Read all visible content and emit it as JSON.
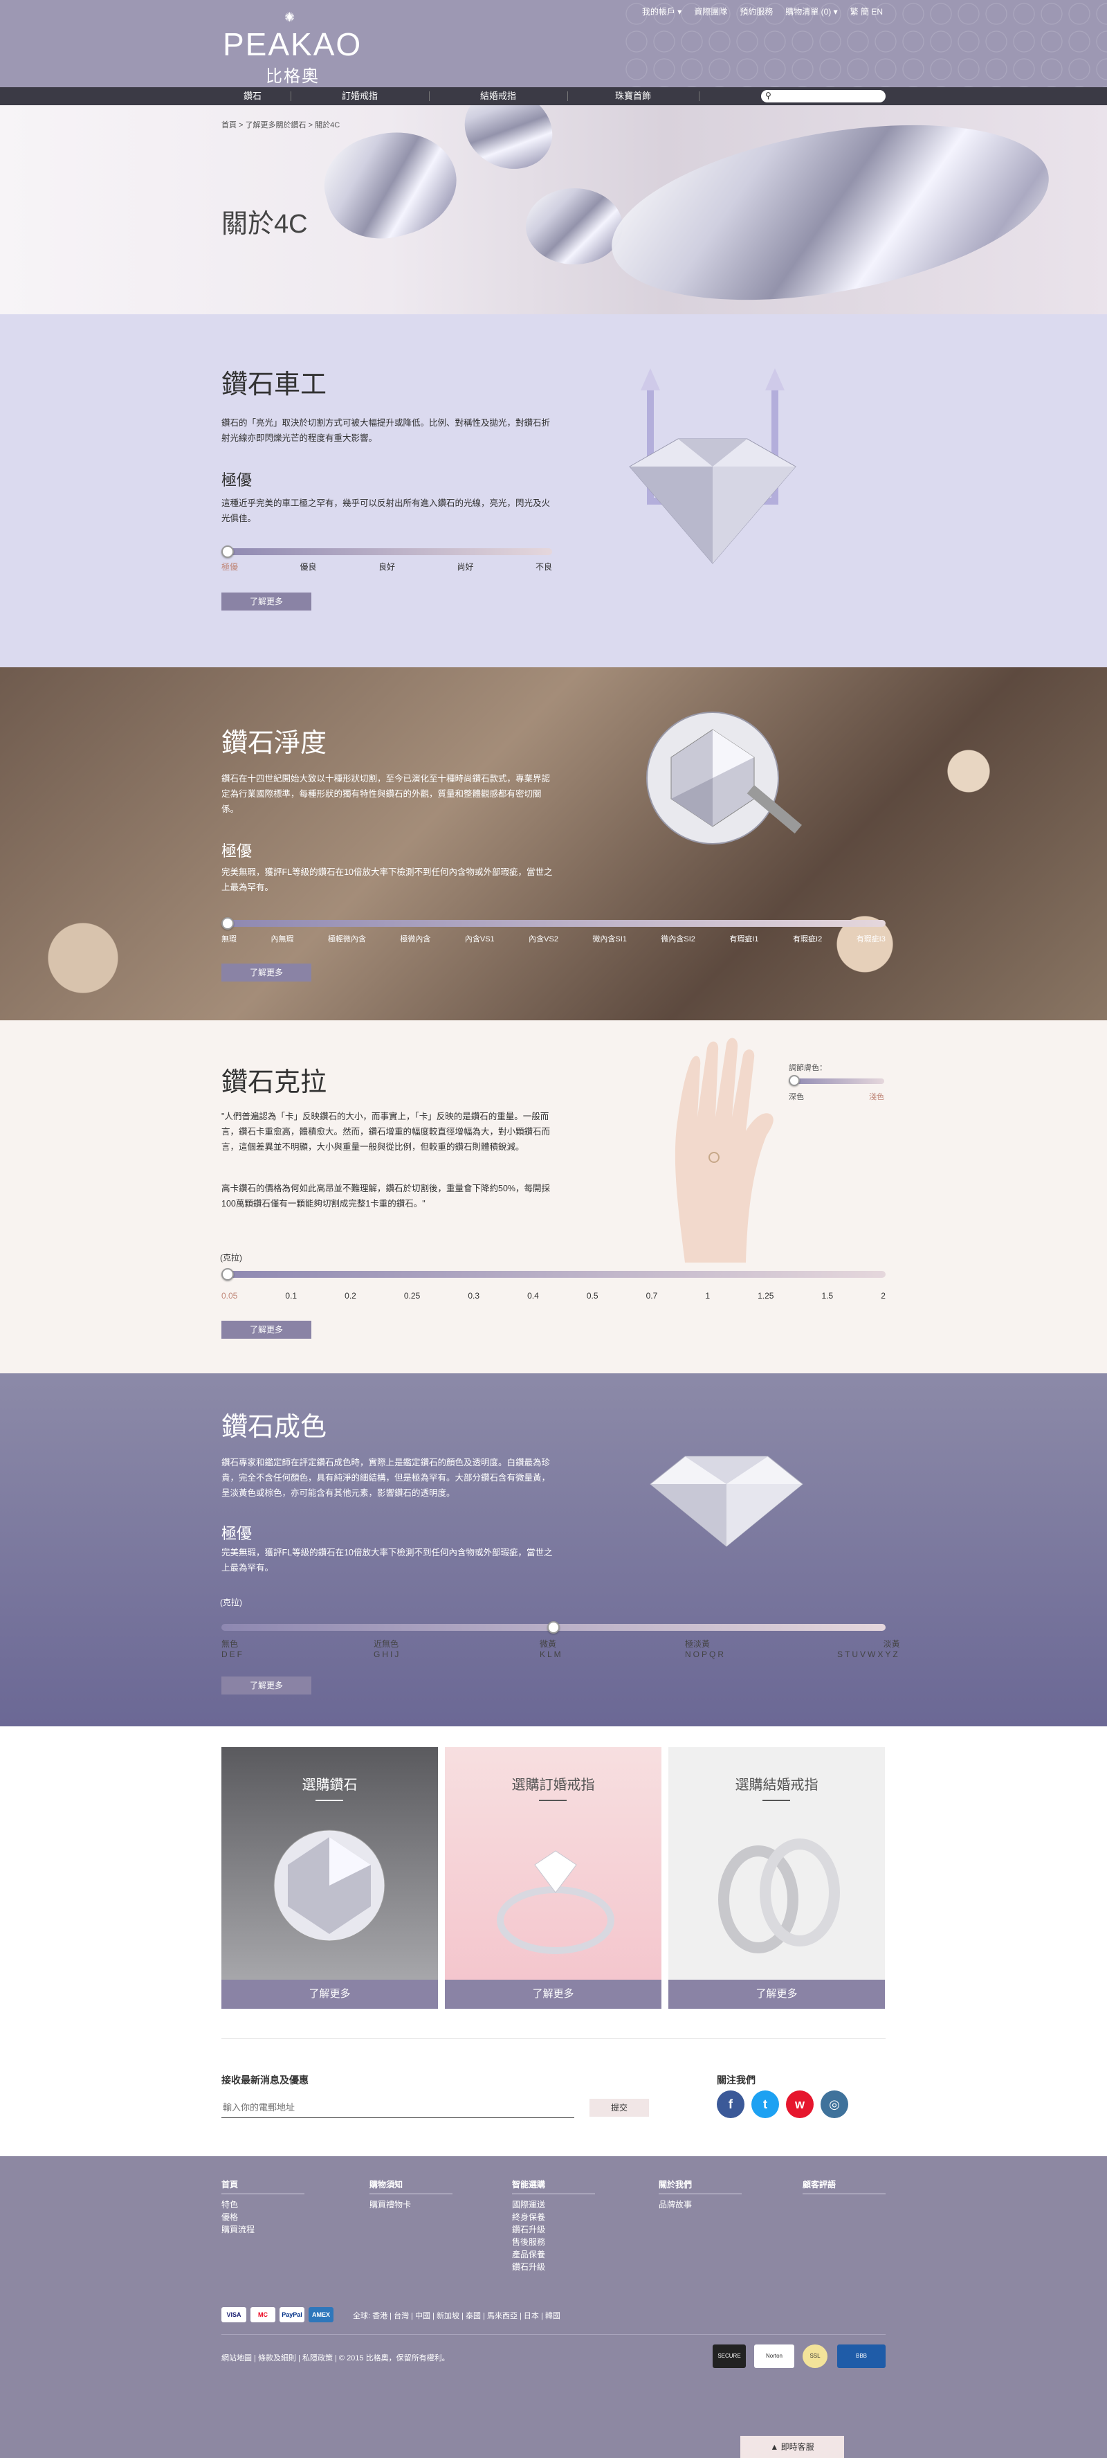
{
  "header": {
    "logo_en": "PEAKAO",
    "logo_zh": "比格奧",
    "top_links": [
      "我的帳戶 ▾",
      "資際團隊",
      "預約服務",
      "購物清單 (0) ▾",
      "繁 簡 EN"
    ]
  },
  "nav": {
    "items": [
      "鑽石",
      "訂婚戒指",
      "結婚戒指",
      "珠寶首飾"
    ],
    "search_placeholder": ""
  },
  "hero": {
    "breadcrumb": [
      "首頁",
      "了解更多關於鑽石",
      "關於4C"
    ],
    "breadcrumb_sep": ">",
    "title": "關於4C"
  },
  "cut": {
    "title": "鑽石車工",
    "desc": "鑽石的「亮光」取決於切割方式可被大幅提升或降低。比例、對稱性及拋光，對鑽石折射光線亦即閃爍光芒的程度有重大影響。",
    "grade": "極優",
    "grade_desc": "這種近乎完美的車工極之罕有，幾乎可以反射出所有進入鑽石的光線，亮光，閃光及火光俱佳。",
    "scale": [
      "極優",
      "優良",
      "良好",
      "尚好",
      "不良"
    ],
    "selected_index": 0,
    "button": "了解更多"
  },
  "clarity": {
    "title": "鑽石淨度",
    "desc": "鑽石在十四世紀開始大致以十種形狀切割，至今已演化至十種時尚鑽石款式，專業界認定為行業國際標準，每種形狀的獨有特性與鑽石的外觀，質量和整體觀感都有密切關係。",
    "grade": "極優",
    "grade_desc": "完美無瑕，獲評FL等級的鑽石在10倍放大率下檢測不到任何內含物或外部瑕疵，當世之上最為罕有。",
    "scale": [
      "無瑕",
      "內無瑕",
      "極輕微內含",
      "極微內含",
      "內含VS1",
      "內含VS2",
      "微內含SI1",
      "微內含SI2",
      "有瑕疵I1",
      "有瑕疵I2",
      "有瑕疵I3"
    ],
    "selected_index": 0,
    "button": "了解更多"
  },
  "carat": {
    "title": "鑽石克拉",
    "desc1": "\"人們普遍認為「卡」反映鑽石的大小，而事實上，「卡」反映的是鑽石的重量。一般而言，鑽石卡重愈高，體積愈大。然而，鑽石增重的幅度較直徑增幅為大，對小顆鑽石而言，這個差異並不明顯，大小與重量一般與從比例，但較重的鑽石則體積銳減。",
    "desc2": "高卡鑽石的價格為何如此高昂並不難理解，鑽石於切割後，重量會下降約50%，每開採100萬顆鑽石僅有一顆能夠切割成完整1卡重的鑽石。\"",
    "skin_label": "調節膚色：",
    "skin_scale": [
      "深色",
      "淺色"
    ],
    "unit": "(克拉)",
    "scale": [
      "0.05",
      "0.1",
      "0.2",
      "0.25",
      "0.3",
      "0.4",
      "0.5",
      "0.7",
      "1",
      "1.25",
      "1.5",
      "2"
    ],
    "selected_index": 0,
    "button": "了解更多"
  },
  "color": {
    "title": "鑽石成色",
    "desc": "鑽石專家和鑑定師在評定鑽石成色時，實際上是鑑定鑽石的顏色及透明度。白鑽最為珍貴，完全不含任何顏色，具有純淨的細結構，但是極為罕有。大部分鑽石含有微量黃，呈淡黃色或棕色，亦可能含有其他元素，影響鑽石的透明度。",
    "grade": "極優",
    "grade_desc": "完美無瑕，獲評FL等級的鑽石在10倍放大率下檢測不到任何內含物或外部瑕疵，當世之上最為罕有。",
    "unit": "(克拉)",
    "scale": [
      {
        "name": "無色",
        "grades": "DEF"
      },
      {
        "name": "近無色",
        "grades": "GHIJ"
      },
      {
        "name": "微黃",
        "grades": "KLM"
      },
      {
        "name": "極淡黃",
        "grades": "NOPQR"
      },
      {
        "name": "淡黃",
        "grades": "STUVWXYZ"
      }
    ],
    "selected_index": 2,
    "selected_fraction": 0.5,
    "button": "了解更多"
  },
  "cards": [
    {
      "title": "選購鑽石",
      "button": "了解更多"
    },
    {
      "title": "選購訂婚戒指",
      "button": "了解更多"
    },
    {
      "title": "選購結婚戒指",
      "button": "了解更多"
    }
  ],
  "newsletter": {
    "title": "接收最新消息及優惠",
    "placeholder": "輸入你的電郵地址",
    "submit": "提交"
  },
  "follow": {
    "title": "關注我們",
    "icons": [
      "facebook-icon",
      "twitter-icon",
      "weibo-icon",
      "instagram-icon"
    ]
  },
  "footer": {
    "columns": [
      {
        "heading": "首頁",
        "links": [
          "特色",
          "優格",
          "購買流程"
        ]
      },
      {
        "heading": "購物須知",
        "links": [
          "購買禮物卡"
        ]
      },
      {
        "heading": "智能選購",
        "links": [
          "國際運送",
          "終身保養",
          "鑽石升級",
          "售後服務",
          "產品保養",
          "鑽石升級"
        ]
      },
      {
        "heading": "關於我們",
        "links": [
          "品牌故事"
        ]
      },
      {
        "heading": "顧客評語",
        "links": []
      }
    ],
    "payments": [
      "VISA",
      "MC",
      "PayPal",
      "AMEX"
    ],
    "regions": "全球: 香港 | 台灣 | 中國 | 新加坡 | 泰國 | 馬來西亞 | 日本 | 韓國",
    "copyright": "網站地圖 | 條款及細則 | 私隱政策 | © 2015 比格奧，保留所有權利。",
    "certs": [
      "SECURE",
      "Norton",
      "SSL",
      "BBB"
    ],
    "chat": "▲ 即時客服"
  },
  "colors": {
    "accent": "#8a83a5",
    "header_bg": "#9d98b3",
    "nav_bg": "#3b3a45",
    "footer_bg": "#8d88a2",
    "cut_bg": "#dbdaef",
    "carat_bg": "#f8f3f0",
    "color_bg": "#7d7a9f"
  }
}
